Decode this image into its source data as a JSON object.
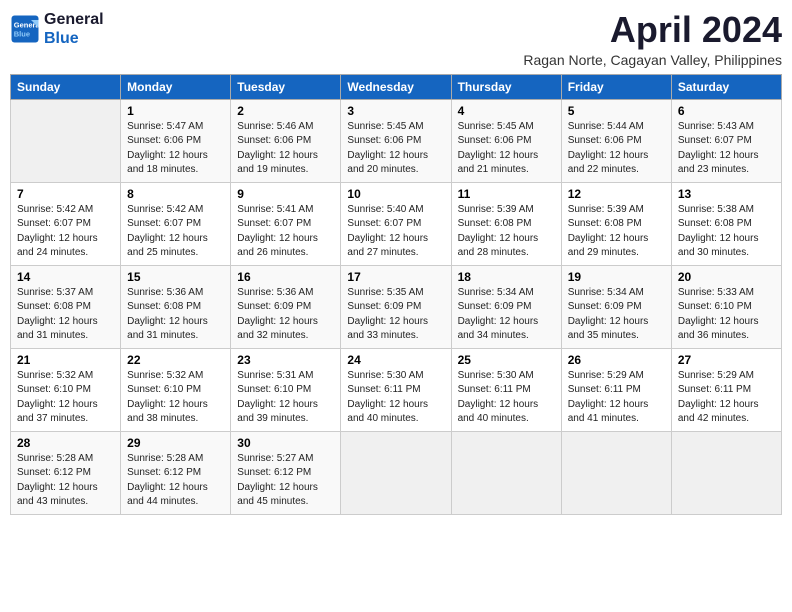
{
  "header": {
    "logo_line1": "General",
    "logo_line2": "Blue",
    "month_title": "April 2024",
    "subtitle": "Ragan Norte, Cagayan Valley, Philippines"
  },
  "columns": [
    "Sunday",
    "Monday",
    "Tuesday",
    "Wednesday",
    "Thursday",
    "Friday",
    "Saturday"
  ],
  "weeks": [
    [
      {
        "day": "",
        "info": ""
      },
      {
        "day": "1",
        "info": "Sunrise: 5:47 AM\nSunset: 6:06 PM\nDaylight: 12 hours\nand 18 minutes."
      },
      {
        "day": "2",
        "info": "Sunrise: 5:46 AM\nSunset: 6:06 PM\nDaylight: 12 hours\nand 19 minutes."
      },
      {
        "day": "3",
        "info": "Sunrise: 5:45 AM\nSunset: 6:06 PM\nDaylight: 12 hours\nand 20 minutes."
      },
      {
        "day": "4",
        "info": "Sunrise: 5:45 AM\nSunset: 6:06 PM\nDaylight: 12 hours\nand 21 minutes."
      },
      {
        "day": "5",
        "info": "Sunrise: 5:44 AM\nSunset: 6:06 PM\nDaylight: 12 hours\nand 22 minutes."
      },
      {
        "day": "6",
        "info": "Sunrise: 5:43 AM\nSunset: 6:07 PM\nDaylight: 12 hours\nand 23 minutes."
      }
    ],
    [
      {
        "day": "7",
        "info": "Sunrise: 5:42 AM\nSunset: 6:07 PM\nDaylight: 12 hours\nand 24 minutes."
      },
      {
        "day": "8",
        "info": "Sunrise: 5:42 AM\nSunset: 6:07 PM\nDaylight: 12 hours\nand 25 minutes."
      },
      {
        "day": "9",
        "info": "Sunrise: 5:41 AM\nSunset: 6:07 PM\nDaylight: 12 hours\nand 26 minutes."
      },
      {
        "day": "10",
        "info": "Sunrise: 5:40 AM\nSunset: 6:07 PM\nDaylight: 12 hours\nand 27 minutes."
      },
      {
        "day": "11",
        "info": "Sunrise: 5:39 AM\nSunset: 6:08 PM\nDaylight: 12 hours\nand 28 minutes."
      },
      {
        "day": "12",
        "info": "Sunrise: 5:39 AM\nSunset: 6:08 PM\nDaylight: 12 hours\nand 29 minutes."
      },
      {
        "day": "13",
        "info": "Sunrise: 5:38 AM\nSunset: 6:08 PM\nDaylight: 12 hours\nand 30 minutes."
      }
    ],
    [
      {
        "day": "14",
        "info": "Sunrise: 5:37 AM\nSunset: 6:08 PM\nDaylight: 12 hours\nand 31 minutes."
      },
      {
        "day": "15",
        "info": "Sunrise: 5:36 AM\nSunset: 6:08 PM\nDaylight: 12 hours\nand 31 minutes."
      },
      {
        "day": "16",
        "info": "Sunrise: 5:36 AM\nSunset: 6:09 PM\nDaylight: 12 hours\nand 32 minutes."
      },
      {
        "day": "17",
        "info": "Sunrise: 5:35 AM\nSunset: 6:09 PM\nDaylight: 12 hours\nand 33 minutes."
      },
      {
        "day": "18",
        "info": "Sunrise: 5:34 AM\nSunset: 6:09 PM\nDaylight: 12 hours\nand 34 minutes."
      },
      {
        "day": "19",
        "info": "Sunrise: 5:34 AM\nSunset: 6:09 PM\nDaylight: 12 hours\nand 35 minutes."
      },
      {
        "day": "20",
        "info": "Sunrise: 5:33 AM\nSunset: 6:10 PM\nDaylight: 12 hours\nand 36 minutes."
      }
    ],
    [
      {
        "day": "21",
        "info": "Sunrise: 5:32 AM\nSunset: 6:10 PM\nDaylight: 12 hours\nand 37 minutes."
      },
      {
        "day": "22",
        "info": "Sunrise: 5:32 AM\nSunset: 6:10 PM\nDaylight: 12 hours\nand 38 minutes."
      },
      {
        "day": "23",
        "info": "Sunrise: 5:31 AM\nSunset: 6:10 PM\nDaylight: 12 hours\nand 39 minutes."
      },
      {
        "day": "24",
        "info": "Sunrise: 5:30 AM\nSunset: 6:11 PM\nDaylight: 12 hours\nand 40 minutes."
      },
      {
        "day": "25",
        "info": "Sunrise: 5:30 AM\nSunset: 6:11 PM\nDaylight: 12 hours\nand 40 minutes."
      },
      {
        "day": "26",
        "info": "Sunrise: 5:29 AM\nSunset: 6:11 PM\nDaylight: 12 hours\nand 41 minutes."
      },
      {
        "day": "27",
        "info": "Sunrise: 5:29 AM\nSunset: 6:11 PM\nDaylight: 12 hours\nand 42 minutes."
      }
    ],
    [
      {
        "day": "28",
        "info": "Sunrise: 5:28 AM\nSunset: 6:12 PM\nDaylight: 12 hours\nand 43 minutes."
      },
      {
        "day": "29",
        "info": "Sunrise: 5:28 AM\nSunset: 6:12 PM\nDaylight: 12 hours\nand 44 minutes."
      },
      {
        "day": "30",
        "info": "Sunrise: 5:27 AM\nSunset: 6:12 PM\nDaylight: 12 hours\nand 45 minutes."
      },
      {
        "day": "",
        "info": ""
      },
      {
        "day": "",
        "info": ""
      },
      {
        "day": "",
        "info": ""
      },
      {
        "day": "",
        "info": ""
      }
    ]
  ]
}
